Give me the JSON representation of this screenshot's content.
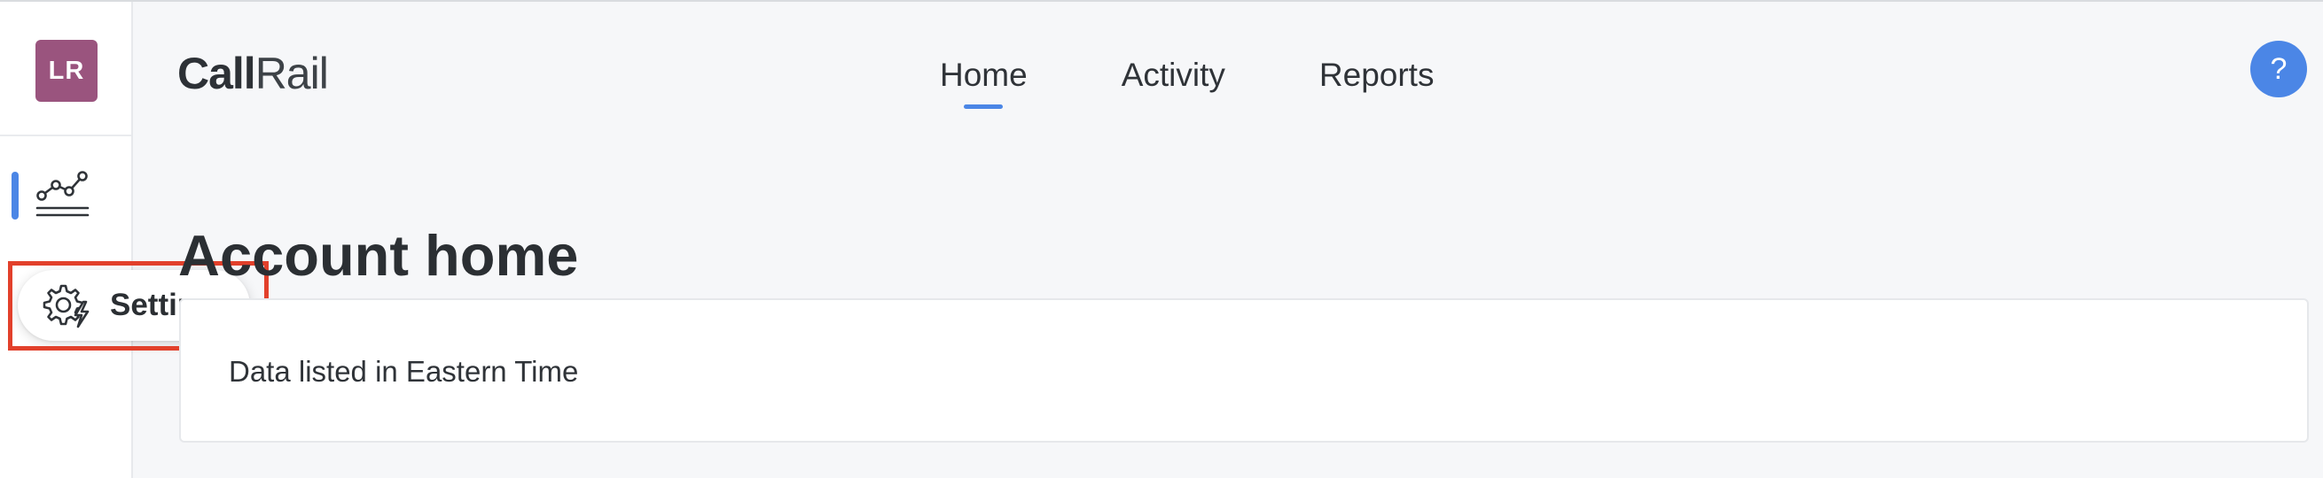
{
  "sidebar": {
    "avatar_initials": "LR",
    "avatar_color": "#9a547e",
    "active_item_icon": "analytics-icon",
    "tooltip": {
      "icon": "gear-lightning-icon",
      "label": "Settings"
    }
  },
  "header": {
    "logo": {
      "bold": "Call",
      "regular": "Rail"
    },
    "nav": [
      {
        "label": "Home",
        "active": true
      },
      {
        "label": "Activity",
        "active": false
      },
      {
        "label": "Reports",
        "active": false
      }
    ],
    "help_label": "?"
  },
  "main": {
    "title": "Account home",
    "timezone_note": "Data listed in Eastern Time"
  },
  "colors": {
    "accent": "#4b86e6",
    "highlight": "#e2402b"
  }
}
